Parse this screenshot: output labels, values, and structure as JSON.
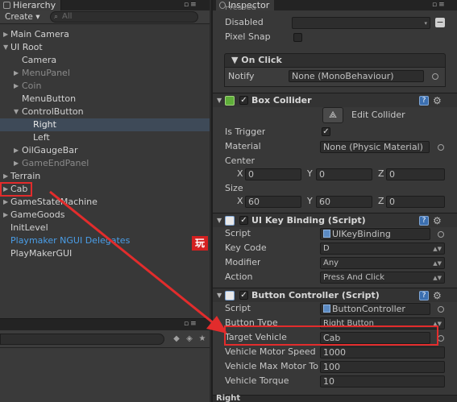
{
  "hierarchy": {
    "tab_label": "Hierarchy",
    "create_label": "Create",
    "search_placeholder": "All",
    "items": [
      {
        "label": "Main Camera"
      },
      {
        "label": "UI Root"
      },
      {
        "label": "Camera"
      },
      {
        "label": "MenuPanel"
      },
      {
        "label": "Coin"
      },
      {
        "label": "MenuButton"
      },
      {
        "label": "ControlButton"
      },
      {
        "label": "Right"
      },
      {
        "label": "Left"
      },
      {
        "label": "OilGaugeBar"
      },
      {
        "label": "GameEndPanel"
      },
      {
        "label": "Terrain"
      },
      {
        "label": "Cab"
      },
      {
        "label": "GameStateMachine"
      },
      {
        "label": "GameGoods"
      },
      {
        "label": "InitLevel"
      },
      {
        "label": "Playmaker NGUI Delegates"
      },
      {
        "label": "PlayMakerGUI"
      }
    ],
    "badge_icon": "玩"
  },
  "inspector": {
    "tab_label": "Inspector",
    "truncated_top_label": "Pressed",
    "disabled_label": "Disabled",
    "pixel_snap_label": "Pixel Snap",
    "on_click": {
      "title": "On Click",
      "notify_label": "Notify",
      "notify_value": "None (MonoBehaviour)"
    },
    "box_collider": {
      "title": "Box Collider",
      "edit_collider_label": "Edit Collider",
      "is_trigger_label": "Is Trigger",
      "material_label": "Material",
      "material_value": "None (Physic Material)",
      "center_label": "Center",
      "center": {
        "x_label": "X",
        "x": "0",
        "y_label": "Y",
        "y": "0",
        "z_label": "Z",
        "z": "0"
      },
      "size_label": "Size",
      "size": {
        "x_label": "X",
        "x": "60",
        "y_label": "Y",
        "y": "60",
        "z_label": "Z",
        "z": "0"
      }
    },
    "ui_key_binding": {
      "title": "UI Key Binding (Script)",
      "script_label": "Script",
      "script_value": "UIKeyBinding",
      "key_code_label": "Key Code",
      "key_code_value": "D",
      "modifier_label": "Modifier",
      "modifier_value": "Any",
      "action_label": "Action",
      "action_value": "Press And Click"
    },
    "button_controller": {
      "title": "Button Controller (Script)",
      "script_label": "Script",
      "script_value": "ButtonController",
      "button_type_label": "Button Type",
      "button_type_value": "Right Button",
      "target_vehicle_label": "Target Vehicle",
      "target_vehicle_value": "Cab",
      "motor_speed_label": "Vehicle Motor Speed",
      "motor_speed_value": "1000",
      "max_motor_label": "Vehicle Max Motor To",
      "max_motor_value": "100",
      "torque_label": "Vehicle Torque",
      "torque_value": "10"
    },
    "next_component_label": "Right"
  },
  "colors": {
    "highlight": "#e22c2c",
    "link_blue": "#4a9ee8",
    "panel": "#383838"
  }
}
